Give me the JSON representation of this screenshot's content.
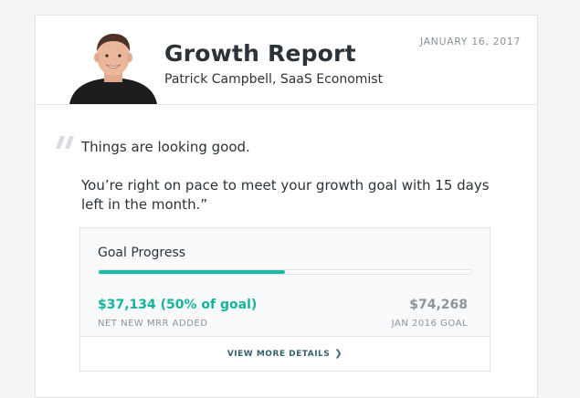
{
  "report": {
    "title": "Growth Report",
    "author": "Patrick Campbell, SaaS Economist",
    "date": "JANUARY 16, 2017"
  },
  "message": {
    "line1": "Things are looking good.",
    "line2": "You’re right on pace to meet your growth goal with 15 days left in the month.”"
  },
  "goal": {
    "title": "Goal Progress",
    "progress_percent": 50,
    "current_value": "$37,134 (50% of goal)",
    "current_label": "NET NEW MRR ADDED",
    "goal_value": "$74,268",
    "goal_label": "JAN 2016 GOAL",
    "details_link": "VIEW MORE DETAILS",
    "details_icon": "chevron-right-icon"
  },
  "colors": {
    "accent": "#1bb9a1",
    "text": "#2c3338",
    "muted": "#8b949c"
  }
}
